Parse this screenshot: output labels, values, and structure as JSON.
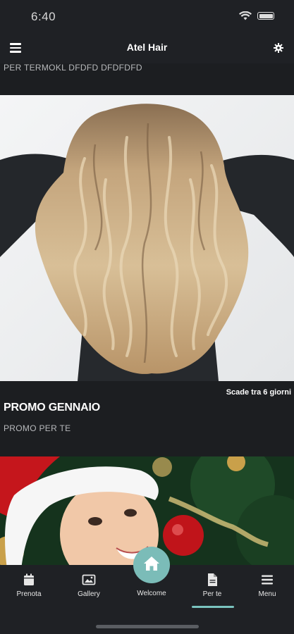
{
  "status_bar": {
    "time": "6:40"
  },
  "header": {
    "title": "Atel Hair"
  },
  "feed": {
    "top_card_subtitle": "PER TERMOKL DFDFD DFDFDFD",
    "promo": {
      "expiry": "Scade tra 6 giorni",
      "title": "PROMO GENNAIO",
      "subtitle": "PROMO PER TE"
    }
  },
  "tabs": [
    {
      "label": "Prenota",
      "icon": "calendar-icon"
    },
    {
      "label": "Gallery",
      "icon": "image-icon"
    },
    {
      "label": "Welcome",
      "icon": "home-icon"
    },
    {
      "label": "Per te",
      "icon": "document-icon"
    },
    {
      "label": "Menu",
      "icon": "list-icon"
    }
  ],
  "colors": {
    "accent": "#7bbcb8",
    "background": "#1c1e21",
    "bar": "#1f2125"
  }
}
